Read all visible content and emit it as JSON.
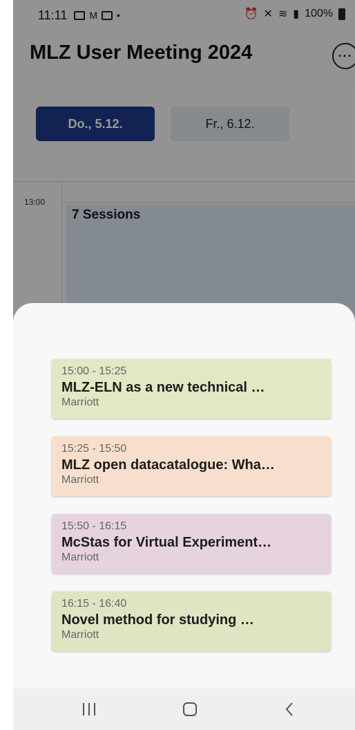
{
  "status_bar": {
    "time": "11:11",
    "left_icons": [
      "gallery-icon",
      "gmail-icon",
      "news-icon",
      "dot-icon"
    ],
    "right_icons": [
      "alarm-icon",
      "mute-icon",
      "wifi-icon",
      "signal-icon"
    ],
    "battery": "100%"
  },
  "app": {
    "title": "MLZ User Meeting 2024",
    "more_icon": "more-options-icon",
    "days": [
      {
        "label": "Do., 5.12.",
        "selected": true
      },
      {
        "label": "Fr., 6.12.",
        "selected": false
      }
    ],
    "timeline": {
      "hour_label": "13:00",
      "session_group_label": "7 Sessions"
    }
  },
  "sheet": {
    "sessions": [
      {
        "time": "15:00 - 15:25",
        "title": "MLZ-ELN as a new technical …",
        "room": "Marriott",
        "color": "#e1e8c4"
      },
      {
        "time": "15:25 - 15:50",
        "title": "MLZ open datacatalogue: Wha…",
        "room": "Marriott",
        "color": "#f8dfcd"
      },
      {
        "time": "15:50 - 16:15",
        "title": "McStas for Virtual Experiment…",
        "room": "Marriott",
        "color": "#e6d3df"
      },
      {
        "time": "16:15 - 16:40",
        "title": "Novel method for studying …",
        "room": "Marriott",
        "color": "#dde5c2"
      }
    ]
  },
  "nav_bar": {
    "icons": [
      "recents-icon",
      "home-icon",
      "back-icon"
    ]
  },
  "colors": {
    "accent": "#1f3a8a",
    "scrim": "rgba(0,0,0,0.40)"
  }
}
